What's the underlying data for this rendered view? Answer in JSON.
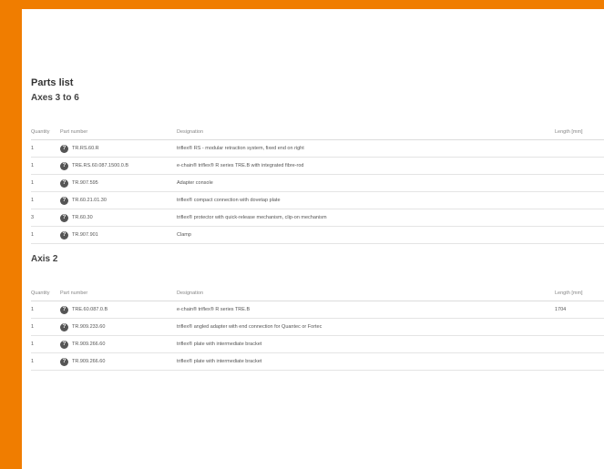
{
  "page": {
    "title": "Parts list"
  },
  "columns": {
    "quantity": "Quantity",
    "part_number": "Part number",
    "designation": "Designation",
    "length": "Length [mm]"
  },
  "info_icon_glyph": "?",
  "sections": [
    {
      "title": "Axes 3 to 6",
      "rows": [
        {
          "quantity": "1",
          "part_number": "TR.RS.60.R",
          "designation": "triflex® RS - modular retraction system, fixed end on right",
          "length": ""
        },
        {
          "quantity": "1",
          "part_number": "TRE.RS.60.087.1500.0.B",
          "designation": "e-chain® triflex® R series TRE.B with integrated fibre-rod",
          "length": ""
        },
        {
          "quantity": "1",
          "part_number": "TR.907.595",
          "designation": "Adapter console",
          "length": ""
        },
        {
          "quantity": "1",
          "part_number": "TR.60.21.01.30",
          "designation": "triflex® compact connection with dovetap plate",
          "length": ""
        },
        {
          "quantity": "3",
          "part_number": "TR.60.30",
          "designation": "triflex® protector with quick-release mechanism, clip-on mechanism",
          "length": ""
        },
        {
          "quantity": "1",
          "part_number": "TR.907.901",
          "designation": "Clamp",
          "length": ""
        }
      ]
    },
    {
      "title": "Axis 2",
      "rows": [
        {
          "quantity": "1",
          "part_number": "TRE.60.087.0.B",
          "designation": "e-chain® triflex® R series TRE.B",
          "length": "1704"
        },
        {
          "quantity": "1",
          "part_number": "TR.909.233.60",
          "designation": "triflex® angled adapter with end connection for Quantec or Fortec",
          "length": ""
        },
        {
          "quantity": "1",
          "part_number": "TR.909.266.60",
          "designation": "triflex® plate with intermediate bracket",
          "length": ""
        },
        {
          "quantity": "1",
          "part_number": "TR.909.266.60",
          "designation": "triflex® plate with intermediate bracket",
          "length": ""
        }
      ]
    }
  ]
}
